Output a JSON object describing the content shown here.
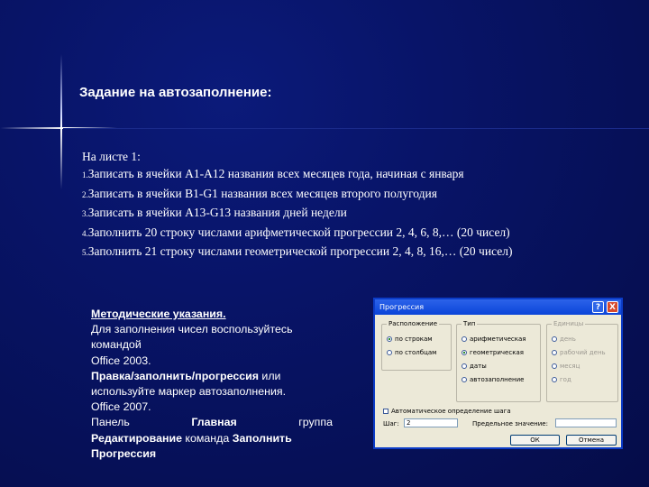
{
  "slide": {
    "title": "Задание на автозаполнение:"
  },
  "task": {
    "intro": "На листе 1:",
    "items": [
      {
        "num": "1.",
        "text": "Записать в ячейки А1-А12 названия всех месяцев года, начиная с января"
      },
      {
        "num": "2.",
        "text": "Записать в ячейки В1-G1 названия всех месяцев второго полугодия"
      },
      {
        "num": "3.",
        "text": "Записать в ячейки А13-G13 названия дней недели"
      },
      {
        "num": "4.",
        "text": "Заполнить 20 строку числами арифметической прогрессии 2, 4, 6, 8,… (20 чисел)"
      },
      {
        "num": "5.",
        "text": "Заполнить 21 строку числами геометрической прогрессии 2, 4, 8, 16,… (20 чисел)"
      }
    ]
  },
  "notes": {
    "heading": "Методические указания.",
    "line1": "Для заполнения чисел воспользуйтесь командой",
    "line2": "Office 2003.",
    "line3_bold": "Правка/заполнить/прогрессия",
    "line3_rest": " или используйте маркер автозаполнения.",
    "line4": "Office 2007.",
    "line5_a": "Панель",
    "line5_b": "Главная",
    "line5_c": "группа",
    "line6_bold": "Редактирование",
    "line6_mid": " команда ",
    "line6_bold2": "Заполнить",
    "line7_bold": "Прогрессия"
  },
  "dialog": {
    "title": "Прогрессия",
    "help_label": "?",
    "close_label": "X",
    "group_location": "Расположение",
    "loc_rows": "по строкам",
    "loc_cols": "по столбцам",
    "group_type": "Тип",
    "type_arith": "арифметическая",
    "type_geom": "геометрическая",
    "type_dates": "даты",
    "type_auto": "автозаполнение",
    "group_units": "Единицы",
    "unit_day": "день",
    "unit_workday": "рабочий день",
    "unit_month": "месяц",
    "unit_year": "год",
    "auto_step": "Автоматическое определение шага",
    "step_label": "Шаг:",
    "step_value": "2",
    "limit_label": "Предельное значение:",
    "limit_value": "",
    "ok_label": "ОК",
    "cancel_label": "Отмена"
  }
}
